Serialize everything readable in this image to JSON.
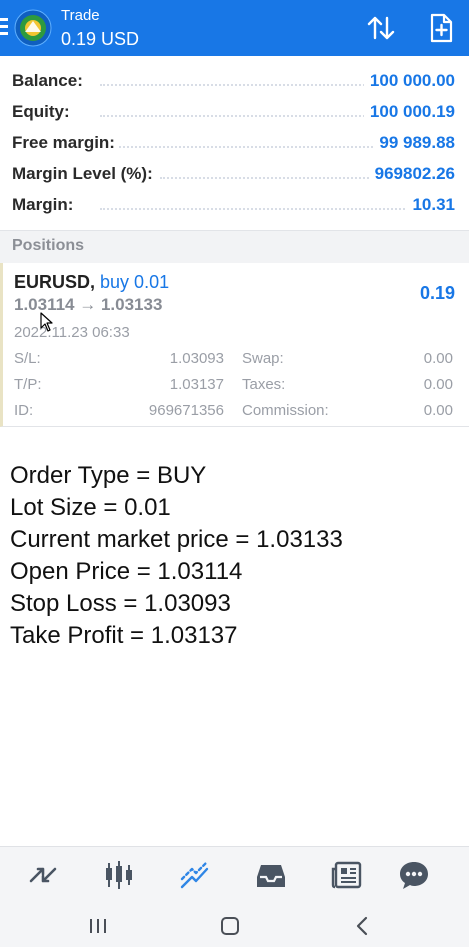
{
  "header": {
    "title_small": "Trade",
    "title_big": "0.19 USD"
  },
  "summary": [
    {
      "label": "Balance:",
      "value": "100 000.00"
    },
    {
      "label": "Equity:",
      "value": "100 000.19"
    },
    {
      "label": "Free margin:",
      "value": "99 989.88"
    },
    {
      "label": "Margin Level (%):",
      "value": "969802.26"
    },
    {
      "label": "Margin:",
      "value": "10.31"
    }
  ],
  "positions_header": "Positions",
  "position": {
    "symbol": "EURUSD,",
    "side": "buy 0.01",
    "prices": "1.03114 → 1.03133",
    "profit": "0.19",
    "time": "2022.11.23 06:33",
    "sl_label": "S/L:",
    "sl_value": "1.03093",
    "tp_label": "T/P:",
    "tp_value": "1.03137",
    "id_label": "ID:",
    "id_value": "969671356",
    "swap_label": "Swap:",
    "swap_value": "0.00",
    "taxes_label": "Taxes:",
    "taxes_value": "0.00",
    "commission_label": "Commission:",
    "commission_value": "0.00"
  },
  "note": [
    "Order Type = BUY",
    "Lot Size = 0.01",
    "Current market price = 1.03133",
    "Open Price = 1.03114",
    "Stop Loss = 1.03093",
    "Take Profit = 1.03137"
  ],
  "colors": {
    "accent": "#1877e6",
    "header_bg": "#1877e6"
  },
  "icons": {
    "top_right": [
      "sort-arrows-icon",
      "new-order-icon"
    ],
    "bottom_nav": [
      "quotes-icon",
      "chart-icon",
      "trade-icon",
      "history-icon",
      "news-icon",
      "chat-icon"
    ],
    "system": [
      "recent-apps-icon",
      "home-icon",
      "back-icon"
    ]
  }
}
